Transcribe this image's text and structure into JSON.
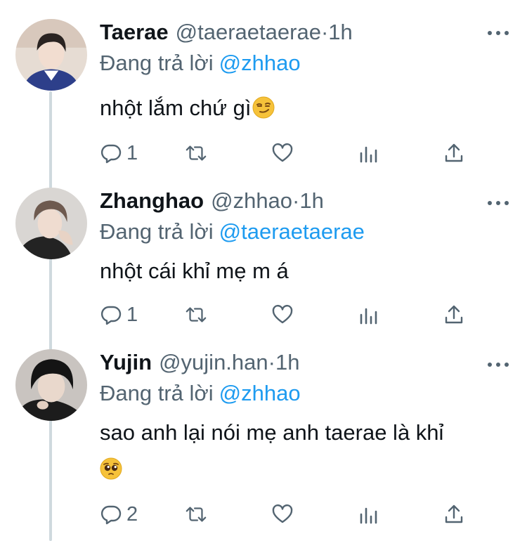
{
  "tweets": [
    {
      "name": "Taerae",
      "handle": "@taeraetaerae",
      "time": "1h",
      "reply_prefix": "Đang trả lời",
      "reply_to": "@zhhao",
      "text": "nhột lắm chứ gì",
      "emoji": "smirking-face",
      "reply_count": "1",
      "avatar_colors": {
        "bg": "#e6dcd3",
        "hair": "#2a2321",
        "skin": "#f2ddd0",
        "shirt": "#2d3f8a"
      }
    },
    {
      "name": "Zhanghao",
      "handle": "@zhhao",
      "time": "1h",
      "reply_prefix": "Đang trả lời",
      "reply_to": "@taeraetaerae",
      "text": "nhột cái khỉ mẹ m á",
      "emoji": "",
      "reply_count": "1",
      "avatar_colors": {
        "bg": "#d9d6d3",
        "hair": "#6e5a4f",
        "skin": "#efdcd0",
        "shirt": "#232323"
      }
    },
    {
      "name": "Yujin",
      "handle": "@yujin.han",
      "time": "1h",
      "reply_prefix": "Đang trả lời",
      "reply_to": "@zhhao",
      "text": "sao anh lại nói mẹ anh taerae là khỉ",
      "emoji": "pleading-face",
      "reply_count": "2",
      "avatar_colors": {
        "bg": "#c9c4c0",
        "hair": "#141414",
        "skin": "#e9d8cc",
        "shirt": "#1c1c1c"
      }
    }
  ],
  "colors": {
    "link": "#1d9bf0",
    "muted": "#536471",
    "text": "#0f1419",
    "thread_line": "#cfd9de"
  }
}
